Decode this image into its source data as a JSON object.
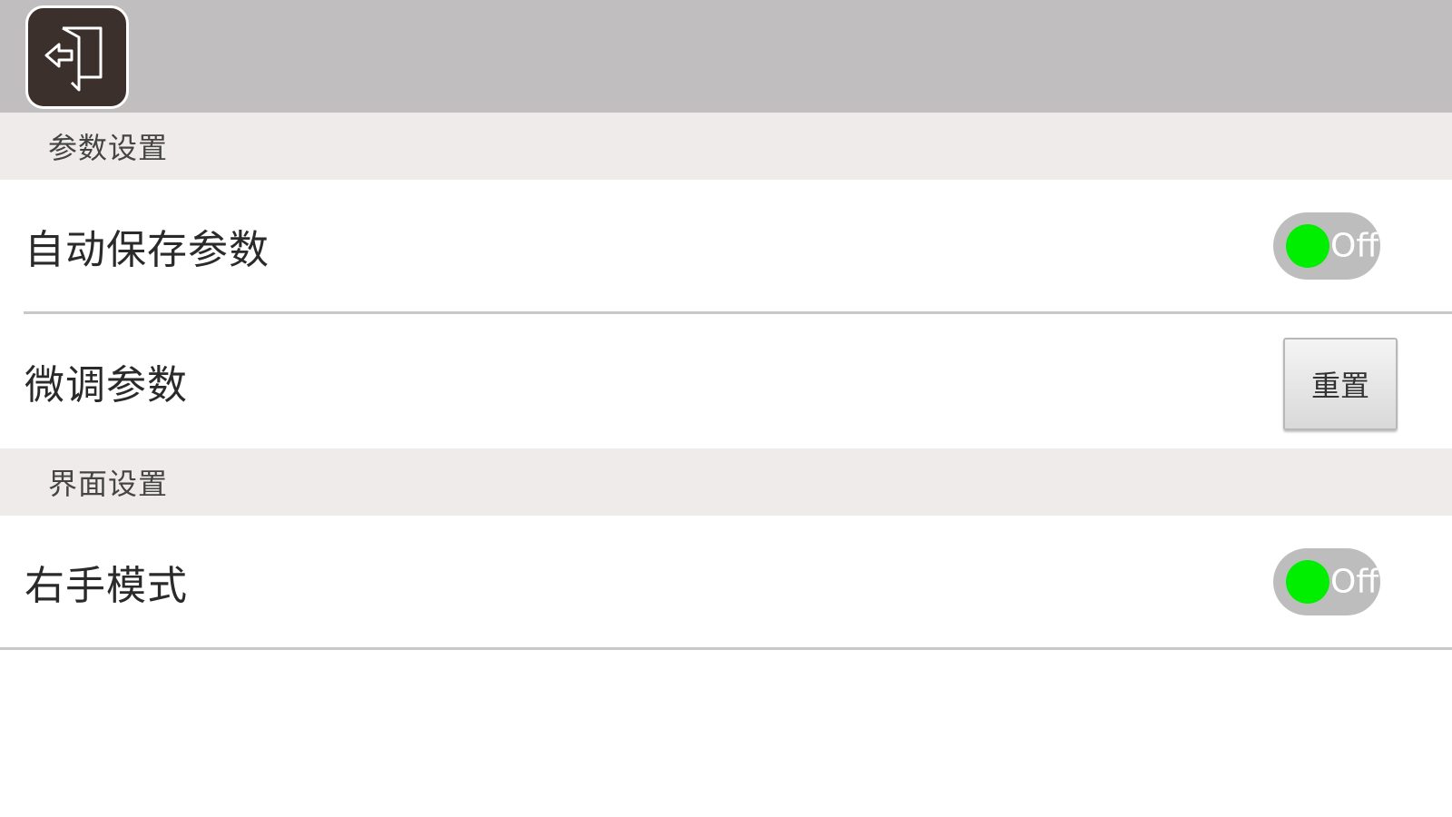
{
  "toolbar": {
    "exit_icon": "exit-icon"
  },
  "sections": [
    {
      "title": "参数设置",
      "rows": [
        {
          "label": "自动保存参数",
          "control": "toggle",
          "state_label": "Off",
          "knob_color": "#00ee00"
        },
        {
          "label": "微调参数",
          "control": "button",
          "button_label": "重置"
        }
      ]
    },
    {
      "title": "界面设置",
      "rows": [
        {
          "label": "右手模式",
          "control": "toggle",
          "state_label": "Off",
          "knob_color": "#00ee00"
        }
      ]
    }
  ],
  "colors": {
    "topbar": "#c0bebf",
    "section_header": "#eeebea",
    "exit_button": "#3b302c",
    "toggle_track": "#bdbdbd",
    "toggle_knob": "#00ee00"
  }
}
